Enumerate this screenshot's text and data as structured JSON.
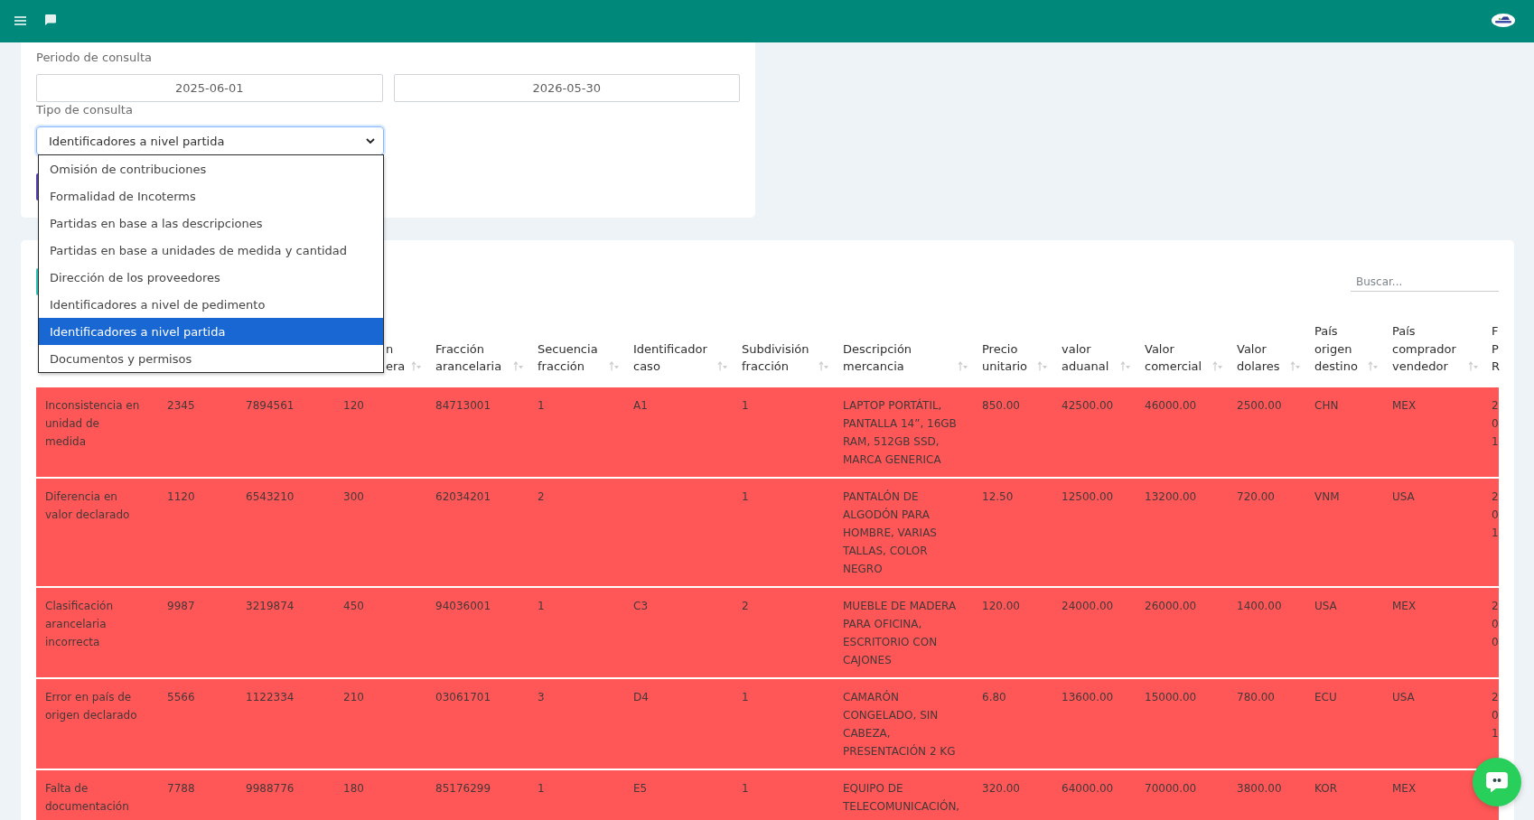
{
  "query_form": {
    "period_label": "Periodo de consulta",
    "start_date": "2025-06-01",
    "end_date": "2026-05-30",
    "type_label": "Tipo de consulta",
    "type_select": {
      "value": "Identificadores a nivel partida",
      "expanded": true,
      "options": [
        {
          "label": "Omisión de contribuciones",
          "selected": false
        },
        {
          "label": "Formalidad de Incoterms",
          "selected": false
        },
        {
          "label": "Partidas en base a las descripciones",
          "selected": false
        },
        {
          "label": "Partidas en base a unidades de medida y cantidad",
          "selected": false
        },
        {
          "label": "Dirección de los proveedores",
          "selected": false
        },
        {
          "label": "Identificadores a nivel de pedimento",
          "selected": false
        },
        {
          "label": "Identificadores a nivel partida",
          "selected": true
        },
        {
          "label": "Documentos y permisos",
          "selected": false
        }
      ]
    }
  },
  "results": {
    "search": {
      "placeholder": "Buscar..."
    },
    "table": {
      "columns": [
        null,
        null,
        null,
        {
          "label": "n era",
          "sortable": true
        },
        {
          "label": "Fracción arancelaria",
          "sortable": true
        },
        {
          "label": "Secuencia fracción",
          "sortable": true
        },
        {
          "label": "Identificador caso",
          "sortable": true
        },
        {
          "label": "Subdivisión fracción",
          "sortable": true
        },
        {
          "label": "Descripción mercancia",
          "sortable": true
        },
        {
          "label": "Precio unitario",
          "sortable": true
        },
        {
          "label": "valor aduanal",
          "sortable": true
        },
        {
          "label": "Valor comercial",
          "sortable": true
        },
        {
          "label": "Valor dolares",
          "sortable": true
        },
        {
          "label": "País origen destino",
          "sortable": true
        },
        {
          "label": "País comprador vendedor",
          "sortable": true
        },
        {
          "label": "F P R"
        }
      ],
      "rows": [
        [
          "Inconsistencia en unidad de medida",
          "2345",
          "7894561",
          "120",
          "84713001",
          "1",
          "A1",
          "1",
          "LAPTOP PORTÁTIL, PANTALLA 14”, 16GB RAM, 512GB SSD, MARCA GENERICA",
          "850.00",
          "42500.00",
          "46000.00",
          "2500.00",
          "CHN",
          "MEX",
          "2 0 1"
        ],
        [
          "Diferencia en valor declarado",
          "1120",
          "6543210",
          "300",
          "62034201",
          "2",
          null,
          "1",
          "PANTALÓN DE ALGODÓN PARA HOMBRE, VARIAS TALLAS, COLOR NEGRO",
          "12.50",
          "12500.00",
          "13200.00",
          "720.00",
          "VNM",
          "USA",
          "2 0 1"
        ],
        [
          "Clasificación arancelaria incorrecta",
          "9987",
          "3219874",
          "450",
          "94036001",
          "1",
          "C3",
          "2",
          "MUEBLE DE MADERA PARA OFICINA, ESCRITORIO CON CAJONES",
          "120.00",
          "24000.00",
          "26000.00",
          "1400.00",
          "USA",
          "MEX",
          "2 0 0"
        ],
        [
          "Error en país de origen declarado",
          "5566",
          "1122334",
          "210",
          "03061701",
          "3",
          "D4",
          "1",
          "CAMARÓN CONGELADO, SIN CABEZA, PRESENTACIÓN 2 KG",
          "6.80",
          "13600.00",
          "15000.00",
          "780.00",
          "ECU",
          "USA",
          "2 0 1"
        ],
        [
          "Falta de documentación",
          "7788",
          "9988776",
          "180",
          "85176299",
          "1",
          "E5",
          "1",
          "EQUIPO DE TELECOMUNICACIÓN,",
          "320.00",
          "64000.00",
          "70000.00",
          "3800.00",
          "KOR",
          "MEX",
          null
        ]
      ]
    }
  }
}
